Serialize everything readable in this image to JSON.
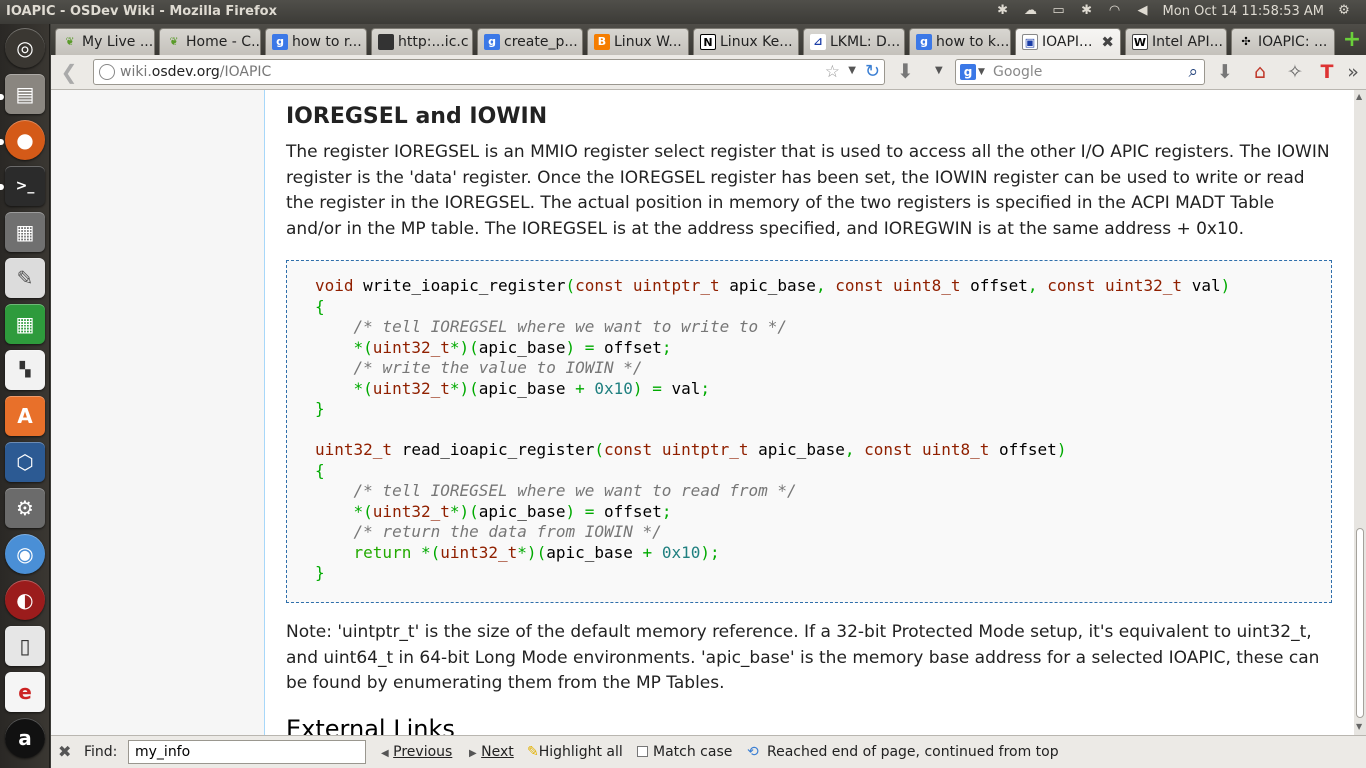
{
  "panel": {
    "window_title": "IOAPIC - OSDev Wiki - Mozilla Firefox",
    "clock": "Mon Oct 14  11:58:53 AM"
  },
  "tabs": [
    {
      "label": "My Live ...",
      "favicon": "leaf-icon"
    },
    {
      "label": "Home - C...",
      "favicon": "leaf-icon"
    },
    {
      "label": "how to r...",
      "favicon": "google-icon"
    },
    {
      "label": "http:...ic.c",
      "favicon": "page-icon"
    },
    {
      "label": "create_p...",
      "favicon": "google-icon"
    },
    {
      "label": "Linux W...",
      "favicon": "blogger-icon"
    },
    {
      "label": "Linux Ke...",
      "favicon": "n-icon"
    },
    {
      "label": "LKML: D...",
      "favicon": "lkml-icon"
    },
    {
      "label": "how to k...",
      "favicon": "google-icon"
    },
    {
      "label": "IOAPI...",
      "favicon": "osdev-icon",
      "active": true
    },
    {
      "label": "Intel API...",
      "favicon": "wikipedia-icon"
    },
    {
      "label": "IOAPIC: ...",
      "favicon": "github-icon"
    }
  ],
  "navbar": {
    "url_host": "wiki.osdev.org",
    "url_prefix": "wiki.",
    "url_domain": "osdev.org",
    "url_path": "/IOAPIC",
    "search_placeholder": "Google"
  },
  "article": {
    "heading": "IOREGSEL and IOWIN",
    "paragraph1": "The register IOREGSEL is an MMIO register select register that is used to access all the other I/O APIC registers. The IOWIN register is the 'data' register. Once the IOREGSEL register has been set, the IOWIN register can be used to write or read the register in the IOREGSEL. The actual position in memory of the two registers is specified in the ACPI MADT Table and/or in the MP table. The IOREGSEL is at the address specified, and IOREGWIN is at the same address + 0x10.",
    "paragraph2": "Note: 'uintptr_t' is the size of the default memory reference. If a 32-bit Protected Mode setup, it's equivalent to uint32_t, and uint64_t in 64-bit Long Mode environments. 'apic_base' is the memory base address for a selected IOAPIC, these can be found by enumerating them from the MP Tables.",
    "next_heading": "External Links"
  },
  "findbar": {
    "label": "Find:",
    "value": "my_info",
    "previous": "Previous",
    "next": "Next",
    "highlight_all": "Highlight all",
    "match_case": "Match case",
    "status": "Reached end of page, continued from top"
  }
}
